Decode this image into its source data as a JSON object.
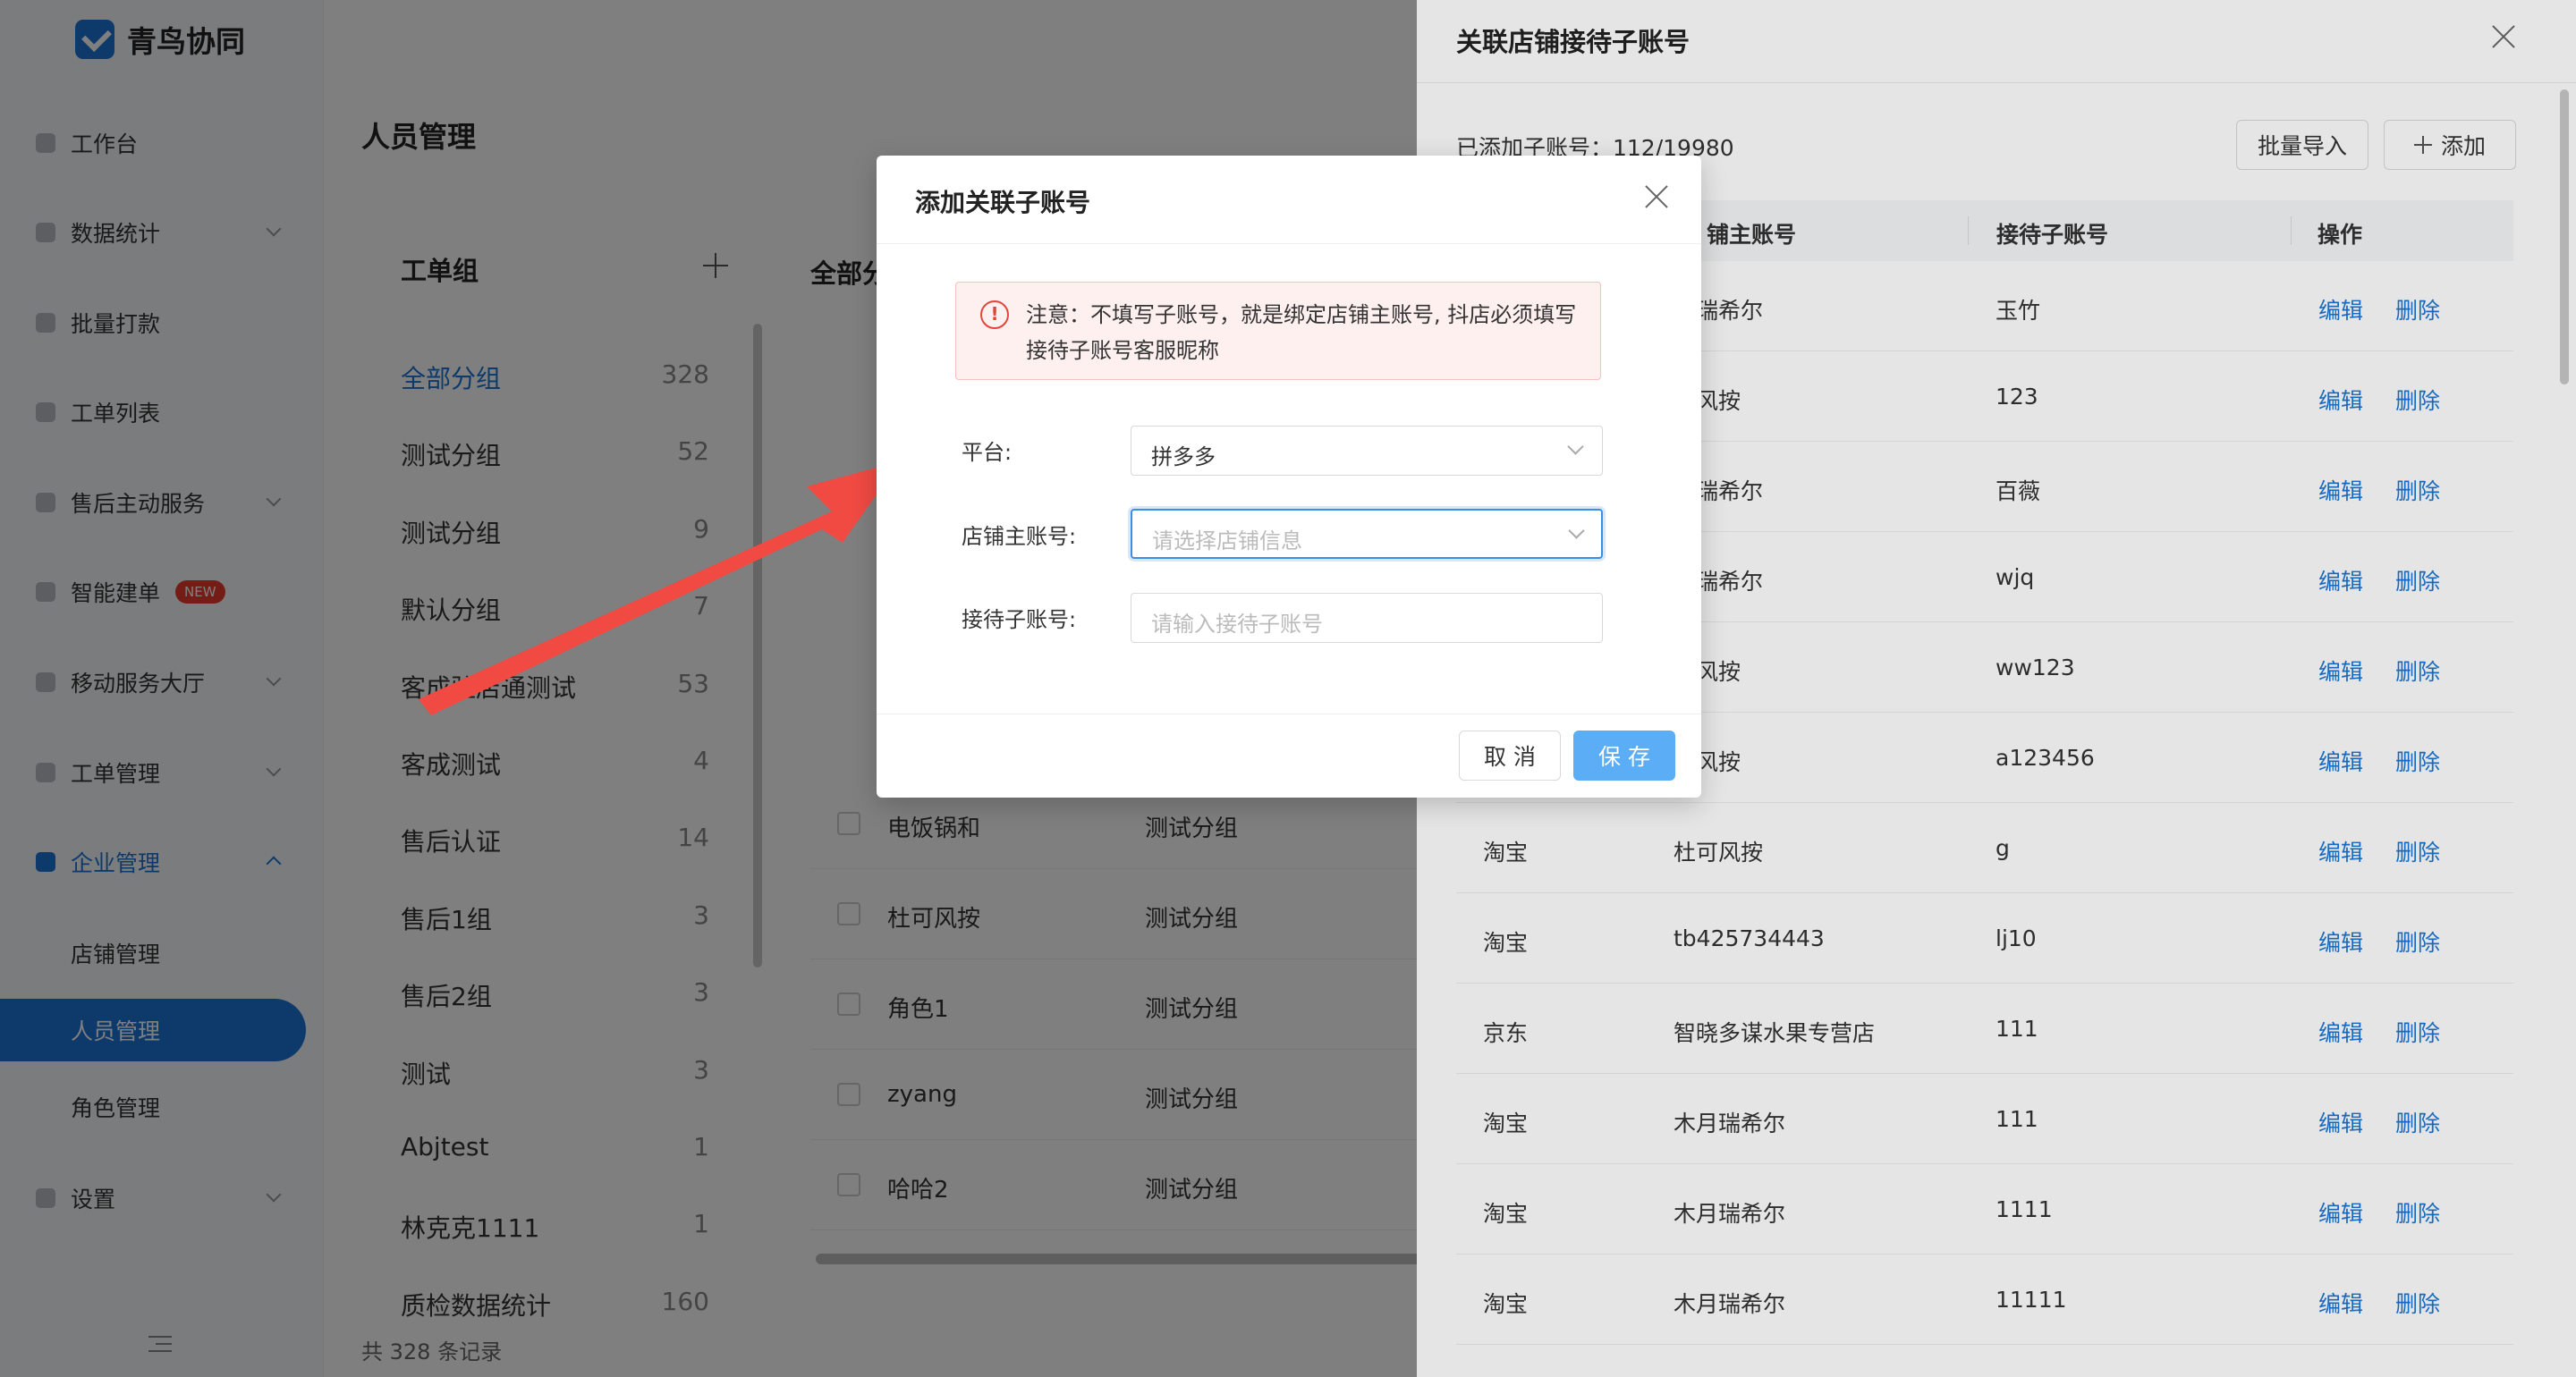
{
  "app": {
    "name": "青鸟协同"
  },
  "sidebar": {
    "items": [
      {
        "label": "工作台"
      },
      {
        "label": "数据统计"
      },
      {
        "label": "批量打款"
      },
      {
        "label": "工单列表"
      },
      {
        "label": "售后主动服务"
      },
      {
        "label": "智能建单",
        "badge": "NEW"
      },
      {
        "label": "移动服务大厅"
      },
      {
        "label": "工单管理"
      },
      {
        "label": "企业管理"
      },
      {
        "label": "设置"
      }
    ],
    "sub_items": [
      {
        "label": "店铺管理"
      },
      {
        "label": "人员管理"
      },
      {
        "label": "角色管理"
      }
    ]
  },
  "page": {
    "title": "人员管理",
    "footer": "共 328 条记录"
  },
  "groups": {
    "title": "工单组",
    "items": [
      {
        "name": "全部分组",
        "count": "328"
      },
      {
        "name": "测试分组",
        "count": "52"
      },
      {
        "name": "测试分组",
        "count": "9"
      },
      {
        "name": "默认分组",
        "count": "7"
      },
      {
        "name": "客成驻店通测试",
        "count": "53"
      },
      {
        "name": "客成测试",
        "count": "4"
      },
      {
        "name": "售后认证",
        "count": "14"
      },
      {
        "name": "售后1组",
        "count": "3"
      },
      {
        "name": "售后2组",
        "count": "3"
      },
      {
        "name": "测试",
        "count": "3"
      },
      {
        "name": "Abjtest",
        "count": "1"
      },
      {
        "name": "林克克1111",
        "count": "1"
      },
      {
        "name": "质检数据统计",
        "count": "160"
      }
    ]
  },
  "list": {
    "header": "全部分",
    "rows": [
      {
        "name": "电饭锅和",
        "group": "测试分组"
      },
      {
        "name": "杜可风按",
        "group": "测试分组"
      },
      {
        "name": "角色1",
        "group": "测试分组"
      },
      {
        "name": "zyang",
        "group": "测试分组"
      },
      {
        "name": "哈哈2",
        "group": "测试分组"
      }
    ]
  },
  "drawer": {
    "title": "关联店铺接待子账号",
    "count_label": "已添加子账号：112/19980",
    "import_label": "批量导入",
    "add_label": "添加",
    "columns": [
      "铺主账号",
      "接待子账号",
      "操作"
    ],
    "rows": [
      {
        "platform": "",
        "main": "月瑞希尔",
        "sub": "玉竹"
      },
      {
        "platform": "",
        "main": "可风按",
        "sub": "123"
      },
      {
        "platform": "",
        "main": "月瑞希尔",
        "sub": "百薇"
      },
      {
        "platform": "",
        "main": "月瑞希尔",
        "sub": "wjq"
      },
      {
        "platform": "",
        "main": "可风按",
        "sub": "ww123"
      },
      {
        "platform": "",
        "main": "可风按",
        "sub": "a123456"
      },
      {
        "platform": "淘宝",
        "main": "杜可风按",
        "sub": "g"
      },
      {
        "platform": "淘宝",
        "main": "tb425734443",
        "sub": "lj10"
      },
      {
        "platform": "京东",
        "main": "智晓多谋水果专营店",
        "sub": "111"
      },
      {
        "platform": "淘宝",
        "main": "木月瑞希尔",
        "sub": "111"
      },
      {
        "platform": "淘宝",
        "main": "木月瑞希尔",
        "sub": "1111"
      },
      {
        "platform": "淘宝",
        "main": "木月瑞希尔",
        "sub": "11111"
      }
    ],
    "edit_label": "编辑",
    "delete_label": "删除"
  },
  "modal": {
    "title": "添加关联子账号",
    "alert": "注意：不填写子账号，就是绑定店铺主账号, 抖店必须填写接待子账号客服昵称",
    "fields": {
      "platform": {
        "label": "平台:",
        "value": "拼多多"
      },
      "shop": {
        "label": "店铺主账号:",
        "placeholder": "请选择店铺信息"
      },
      "sub": {
        "label": "接待子账号:",
        "placeholder": "请输入接待子账号"
      }
    },
    "cancel_label": "取 消",
    "save_label": "保 存"
  },
  "colors": {
    "accent": "#1a75d6",
    "save_button": "#5baef5",
    "alert_bg": "#fef0ef",
    "arrow": "#f04a43",
    "badge": "#e83b2e"
  }
}
